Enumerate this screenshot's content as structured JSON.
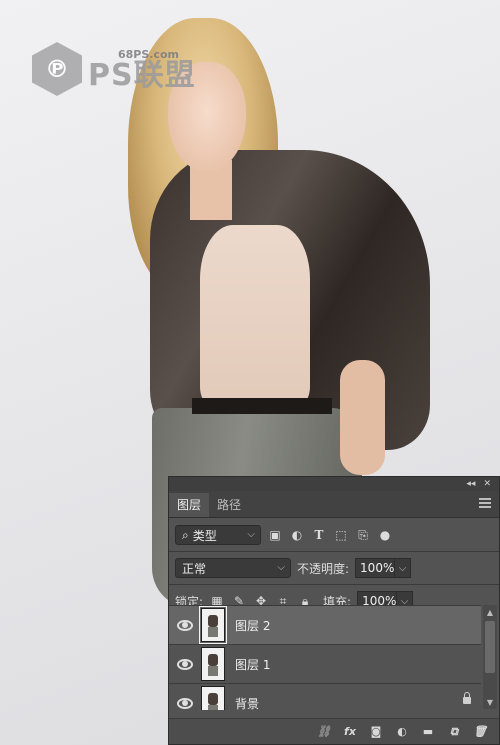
{
  "watermark": {
    "site": "68PS.com",
    "name": "PS联盟"
  },
  "panel": {
    "tabs": [
      {
        "label": "图层",
        "active": true
      },
      {
        "label": "路径",
        "active": false
      }
    ],
    "filter": {
      "selected": "类型"
    },
    "blend": {
      "mode": "正常",
      "opacity_label": "不透明度:",
      "opacity_value": "100%"
    },
    "lock": {
      "label": "锁定:",
      "fill_label": "填充:",
      "fill_value": "100%"
    },
    "layers": [
      {
        "name": "图层 2",
        "selected": true,
        "visible": true,
        "locked": false
      },
      {
        "name": "图层 1",
        "selected": false,
        "visible": true,
        "locked": false
      },
      {
        "name": "背景",
        "selected": false,
        "visible": true,
        "locked": true
      }
    ],
    "footer_icons": [
      "link-icon",
      "fx-icon",
      "mask-icon",
      "adjustment-icon",
      "folder-icon",
      "new-layer-icon",
      "trash-icon"
    ]
  }
}
